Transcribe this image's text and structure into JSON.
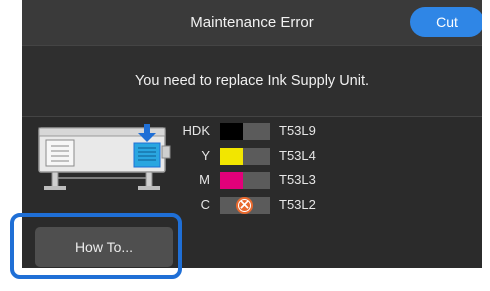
{
  "header": {
    "title": "Maintenance Error",
    "cut_label": "Cut"
  },
  "message": {
    "text": "You need to replace Ink Supply Unit."
  },
  "ink": [
    {
      "name": "HDK",
      "code": "T53L9",
      "color": "#000000",
      "status": "ok"
    },
    {
      "name": "Y",
      "code": "T53L4",
      "color": "#f2e600",
      "status": "ok"
    },
    {
      "name": "M",
      "code": "T53L3",
      "color": "#e2007a",
      "status": "ok"
    },
    {
      "name": "C",
      "code": "T53L2",
      "color": "#e8692e",
      "status": "error"
    }
  ],
  "buttons": {
    "how_to_label": "How To..."
  },
  "colors": {
    "accent": "#2f86e6",
    "highlight": "#1f6fd6",
    "error": "#e8692e"
  },
  "icons": {
    "error": "error-x-icon",
    "insert_arrow": "down-arrow-icon"
  }
}
